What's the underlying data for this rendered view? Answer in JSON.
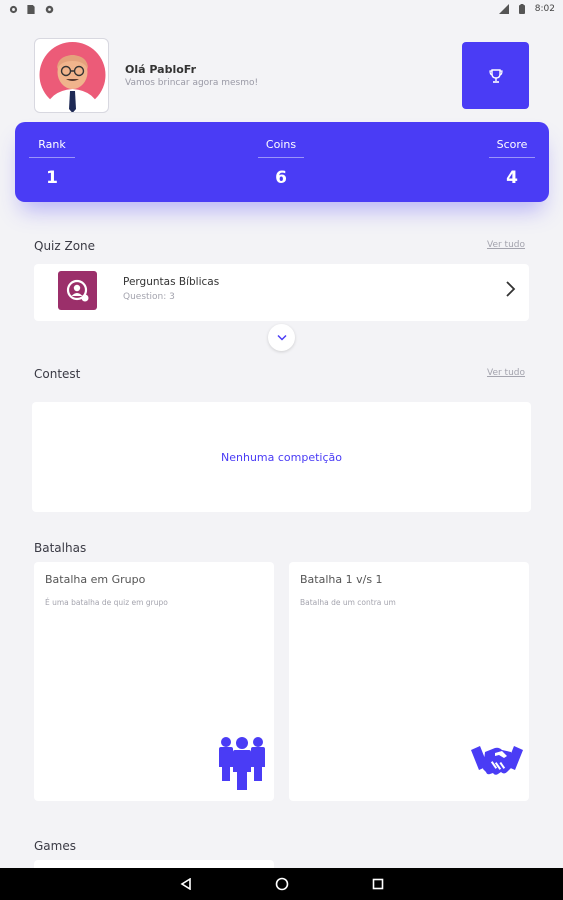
{
  "status_bar": {
    "time": "8:02",
    "left_icons": [
      "message-icon",
      "sim-icon",
      "settings-icon"
    ],
    "right_icons": [
      "signal-icon",
      "battery-icon"
    ]
  },
  "header": {
    "greeting": "Olá PabloFr",
    "subtitle": "Vamos brincar agora mesmo!",
    "avatar_icon": "avatar-man-glasses",
    "trophy_icon": "trophy-icon"
  },
  "stats": {
    "rank_label": "Rank",
    "rank_value": "1",
    "coins_label": "Coins",
    "coins_value": "6",
    "score_label": "Score",
    "score_value": "4"
  },
  "quiz_zone": {
    "title": "Quiz Zone",
    "see_all": "Ver tudo",
    "items": [
      {
        "title": "Perguntas Bíblicas",
        "subtitle": "Question: 3",
        "icon": "quiz-category-icon"
      }
    ]
  },
  "contest": {
    "title": "Contest",
    "see_all": "Ver tudo",
    "empty_message": "Nenhuma competição"
  },
  "battles": {
    "title": "Batalhas",
    "items": [
      {
        "title": "Batalha em Grupo",
        "description": "É uma batalha de quiz em grupo",
        "icon": "group-people-icon"
      },
      {
        "title": "Batalha 1 v/s 1",
        "description": "Batalha de um contra um",
        "icon": "handshake-icon"
      }
    ]
  },
  "games": {
    "title": "Games"
  },
  "colors": {
    "accent": "#4a3cf5",
    "background": "#f3f3f6",
    "quiz_icon_bg": "#9b2f6a",
    "avatar_bg": "#ec5b78"
  }
}
